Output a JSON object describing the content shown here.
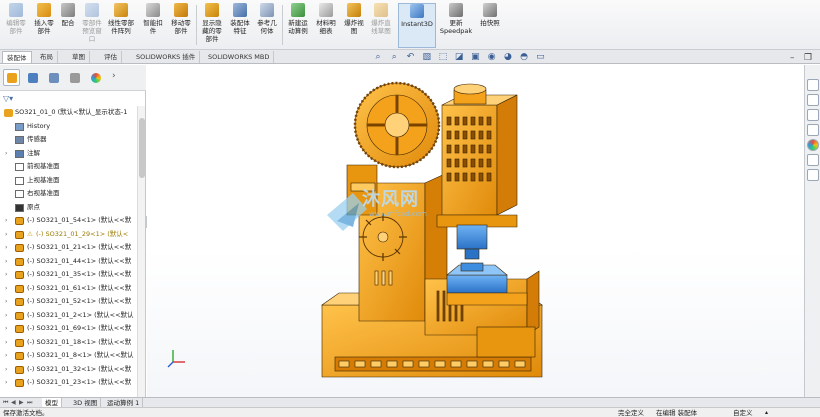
{
  "ribbon": {
    "buttons": [
      {
        "id": "edit-component",
        "lines": [
          "编辑零",
          "部件"
        ],
        "disabled": true
      },
      {
        "id": "insert-component",
        "lines": [
          "插入零",
          "部件"
        ],
        "disabled": false
      },
      {
        "id": "mate",
        "lines": [
          "配合"
        ],
        "disabled": false
      },
      {
        "id": "component-preview",
        "lines": [
          "零部件",
          "预览窗",
          "口"
        ],
        "disabled": true
      },
      {
        "id": "linear-pattern",
        "lines": [
          "线性零部",
          "件阵列"
        ],
        "disabled": false
      },
      {
        "id": "smart-fasteners",
        "lines": [
          "智能扣",
          "件"
        ],
        "disabled": false
      },
      {
        "id": "move-component",
        "lines": [
          "移动零",
          "部件"
        ],
        "disabled": false
      },
      {
        "id": "show-hidden",
        "lines": [
          "显示隐",
          "藏的零",
          "部件"
        ],
        "disabled": false
      },
      {
        "id": "assembly-feature",
        "lines": [
          "装配体",
          "特征"
        ],
        "disabled": false
      },
      {
        "id": "reference-geometry",
        "lines": [
          "参考几",
          "何体"
        ],
        "disabled": false
      },
      {
        "id": "new-motion-study",
        "lines": [
          "新建运",
          "动算例"
        ],
        "disabled": false
      },
      {
        "id": "bill-of-materials",
        "lines": [
          "材料明",
          "细表"
        ],
        "disabled": false
      },
      {
        "id": "exploded-view",
        "lines": [
          "爆炸视",
          "图"
        ],
        "disabled": false
      },
      {
        "id": "explode-line-sketch",
        "lines": [
          "爆炸直",
          "线草图"
        ],
        "disabled": true
      },
      {
        "id": "instant3d",
        "lines": [
          "Instant3D"
        ],
        "disabled": false,
        "active": true
      },
      {
        "id": "update-speedpak",
        "lines": [
          "更新",
          "Speedpak"
        ],
        "disabled": false
      },
      {
        "id": "take-snapshot",
        "lines": [
          "拍快照"
        ],
        "disabled": false
      }
    ]
  },
  "command_tabs": [
    "装配体",
    "布局",
    "草图",
    "评估",
    "SOLIDWORKS 插件",
    "SOLIDWORKS MBD"
  ],
  "feature_tree": {
    "root": "SO321_01_0 (默认<默认_显示状态-1",
    "items": [
      {
        "label": "History",
        "icon": "history-icon",
        "expand": false
      },
      {
        "label": "传感器",
        "icon": "sensor-icon",
        "expand": false
      },
      {
        "label": "注解",
        "icon": "annotation-icon",
        "expand": true
      },
      {
        "label": "前视基准面",
        "icon": "plane-icon",
        "expand": false
      },
      {
        "label": "上视基准面",
        "icon": "plane-icon",
        "expand": false
      },
      {
        "label": "右视基准面",
        "icon": "plane-icon",
        "expand": false
      },
      {
        "label": "原点",
        "icon": "origin-icon",
        "expand": false
      },
      {
        "label": "(-) SO321_01_54<1> (默认<<默",
        "icon": "part-icon",
        "expand": true
      },
      {
        "label": "(-) SO321_01_29<1> (默认<",
        "icon": "part-icon",
        "expand": true,
        "warning": true
      },
      {
        "label": "(-) SO321_01_21<1> (默认<<默",
        "icon": "part-icon",
        "expand": true
      },
      {
        "label": "(-) SO321_01_44<1> (默认<<默",
        "icon": "part-icon",
        "expand": true
      },
      {
        "label": "(-) SO321_01_35<1> (默认<<默",
        "icon": "part-icon",
        "expand": true
      },
      {
        "label": "(-) SO321_01_61<1> (默认<<默",
        "icon": "part-icon",
        "expand": true
      },
      {
        "label": "(-) SO321_01_52<1> (默认<<默",
        "icon": "part-icon",
        "expand": true
      },
      {
        "label": "(-) SO321_01_2<1> (默认<<默认",
        "icon": "part-icon",
        "expand": true
      },
      {
        "label": "(-) SO321_01_69<1> (默认<<默",
        "icon": "part-icon",
        "expand": true
      },
      {
        "label": "(-) SO321_01_18<1> (默认<<默",
        "icon": "part-icon",
        "expand": true
      },
      {
        "label": "(-) SO321_01_8<1> (默认<<默认",
        "icon": "part-icon",
        "expand": true
      },
      {
        "label": "(-) SO321_01_32<1> (默认<<默",
        "icon": "part-icon",
        "expand": true
      },
      {
        "label": "(-) SO321_01_23<1> (默认<<默",
        "icon": "part-icon",
        "expand": true
      }
    ]
  },
  "bottom_tabs": [
    "模型",
    "3D 视图",
    "运动算例 1"
  ],
  "status": {
    "message": "保存激活文档。",
    "constraint": "完全定义",
    "editing": "在编辑 装配体",
    "units": "自定义"
  },
  "watermark": {
    "brand": "沐风网",
    "url": "www.mfcad.com"
  },
  "colors": {
    "model": "#f4a21c",
    "model_dark": "#b86a06",
    "part_blue": "#3d8ee0",
    "selection": "#dbe8f6"
  }
}
